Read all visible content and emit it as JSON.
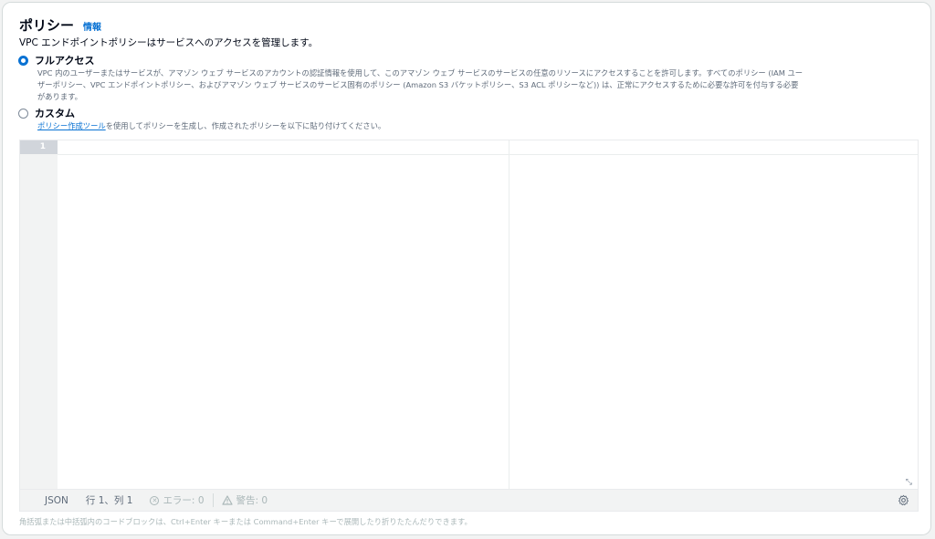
{
  "header": {
    "title": "ポリシー",
    "info_link": "情報"
  },
  "description": "VPC エンドポイントポリシーはサービスへのアクセスを管理します。",
  "options": {
    "full_access": {
      "label": "フルアクセス",
      "selected": true,
      "desc_line1": "VPC 内のユーザーまたはサービスが、アマゾン ウェブ サービスのアカウントの認証情報を使用して、このアマゾン ウェブ サービスのサービスの任意のリソースにアクセスすることを許可します。すべてのポリシー (IAM ユー",
      "desc_line2": "ザーポリシー、VPC エンドポイントポリシー、およびアマゾン ウェブ サービスのサービス固有のポリシー (Amazon S3 バケットポリシー、S3 ACL ポリシーなど)) は、正常にアクセスするために必要な許可を付与する必要",
      "desc_line3": "があります。"
    },
    "custom": {
      "label": "カスタム",
      "selected": false,
      "link_text": "ポリシー作成ツール",
      "desc_rest": "を使用してポリシーを生成し、作成されたポリシーを以下に貼り付けてください。"
    }
  },
  "editor": {
    "line_number": "1",
    "content": "",
    "status": {
      "language": "JSON",
      "position": "行 1、列 1",
      "errors": "エラー: 0",
      "warnings": "警告: 0"
    }
  },
  "footer_hint": "角括弧または中括弧内のコードブロックは、Ctrl+Enter キーまたは Command+Enter キーで展開したり折りたたんだりできます。",
  "icons": {
    "error": "circle-x-icon",
    "warning": "warning-triangle-icon",
    "settings": "gear-icon",
    "resize": "resize-handle-icon"
  },
  "colors": {
    "accent": "#0972d3",
    "muted": "#5f6b7a",
    "disabled": "#aab7b8"
  }
}
